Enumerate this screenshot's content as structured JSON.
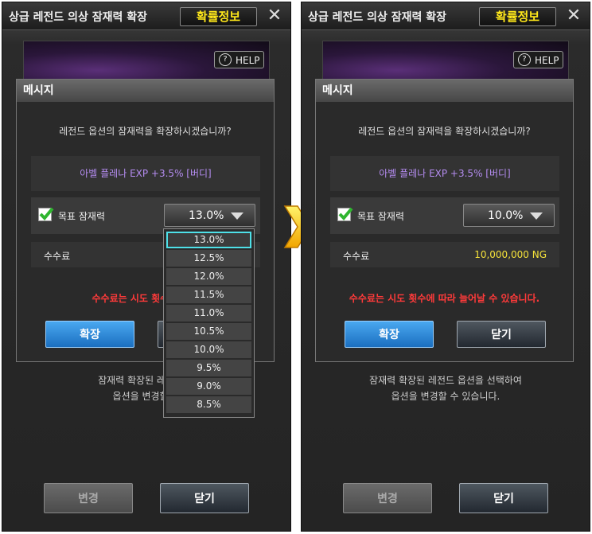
{
  "window": {
    "title": "상급 레전드 의상 잠재력 확장",
    "prob_button": "확률정보",
    "close_icon": "close-icon",
    "help_label": "HELP"
  },
  "dialog": {
    "title": "메시지",
    "question": "레전드 옵션의 잠재력을 확장하시겠습니까?",
    "option_text": "아벨 플레나 EXP +3.5% [버디]",
    "target_label": "목표 잠재력",
    "fee_label": "수수료",
    "warning": "수수료는 시도 횟수에 따라 늘어날 수 있습니다.",
    "expand_button": "확장",
    "close_button": "닫기"
  },
  "left": {
    "selected_value": "13.0%",
    "warning_visible": "수수료는 시도 횟수에 따라",
    "dialog_close_partial": "",
    "bottom_line1": "잠재력 확장된 레전드 옵",
    "bottom_line2": "옵션을 변경할 수"
  },
  "right": {
    "selected_value": "10.0%",
    "fee_value": "10,000,000 NG",
    "bottom_line1": "잠재력 확장된 레전드 옵션을 선택하여",
    "bottom_line2": "옵션을 변경할 수 있습니다."
  },
  "dropdown": {
    "options": [
      "13.0%",
      "12.5%",
      "12.0%",
      "11.5%",
      "11.0%",
      "10.5%",
      "10.0%",
      "9.5%",
      "9.0%",
      "8.5%"
    ],
    "selected_index": 0
  },
  "bottom_buttons": {
    "change": "변경",
    "close": "닫기"
  },
  "colors": {
    "accent_yellow": "#ffe81a",
    "option_purple": "#b48cf0",
    "warning_red": "#ff3a3a",
    "highlight_cyan": "#4ee0e8",
    "button_blue": "#2f8ad8"
  }
}
